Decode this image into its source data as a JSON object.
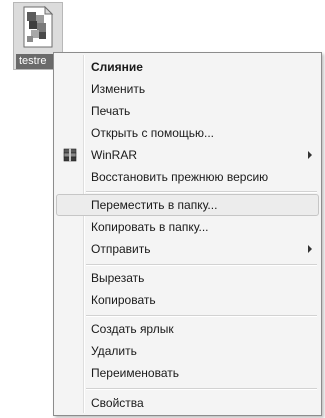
{
  "file": {
    "label": "testre",
    "icon": "office-document-icon"
  },
  "menu": {
    "groups": [
      {
        "items": [
          {
            "label": "Слияние",
            "bold": true
          },
          {
            "label": "Изменить"
          },
          {
            "label": "Печать"
          },
          {
            "label": "Открыть с помощью..."
          },
          {
            "label": "WinRAR",
            "icon": "winrar-icon",
            "submenu": true
          },
          {
            "label": "Восстановить прежнюю версию"
          }
        ]
      },
      {
        "items": [
          {
            "label": "Переместить в папку...",
            "highlighted": true
          },
          {
            "label": "Копировать в папку..."
          },
          {
            "label": "Отправить",
            "submenu": true
          }
        ]
      },
      {
        "items": [
          {
            "label": "Вырезать"
          },
          {
            "label": "Копировать"
          }
        ]
      },
      {
        "items": [
          {
            "label": "Создать ярлык"
          },
          {
            "label": "Удалить"
          },
          {
            "label": "Переименовать"
          }
        ]
      },
      {
        "items": [
          {
            "label": "Свойства"
          }
        ]
      }
    ]
  }
}
